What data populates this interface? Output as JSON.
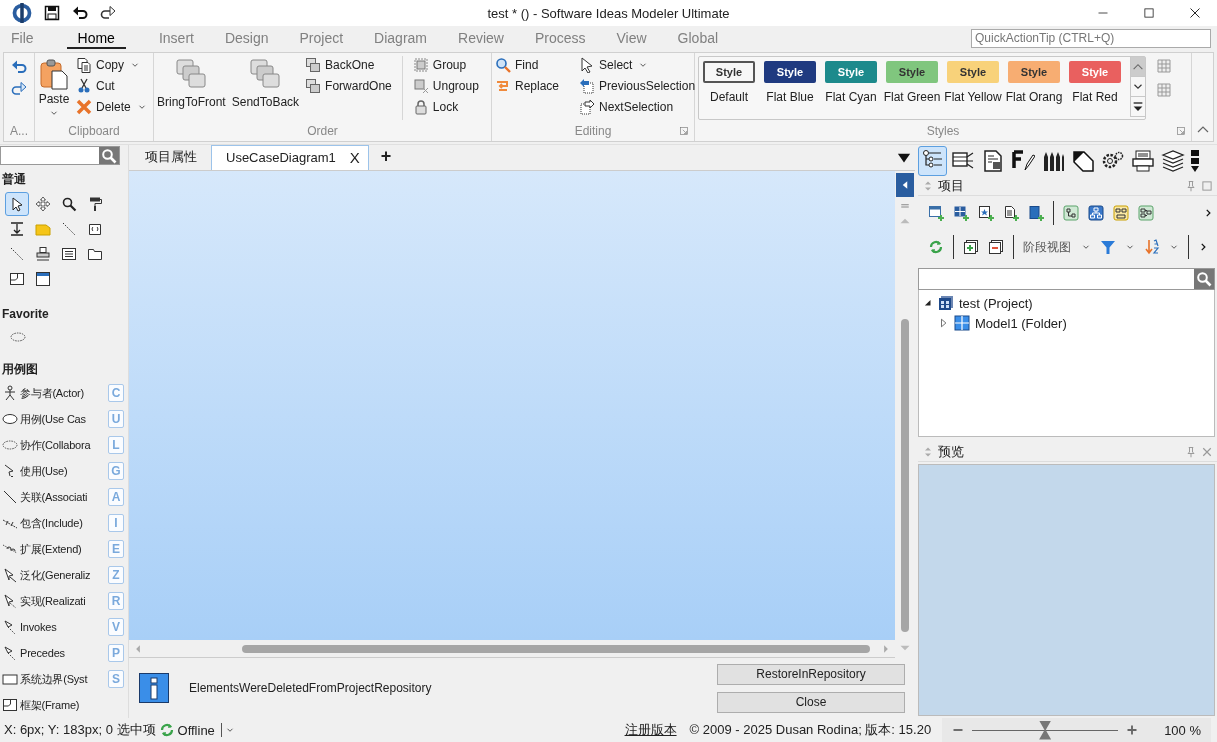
{
  "window": {
    "title": "test *  ()  - Software Ideas Modeler Ultimate"
  },
  "ribbon_tabs": [
    {
      "label": "File",
      "selected": false
    },
    {
      "label": "Home",
      "selected": true
    },
    {
      "label": "Insert",
      "selected": false
    },
    {
      "label": "Design",
      "selected": false
    },
    {
      "label": "Project",
      "selected": false
    },
    {
      "label": "Diagram",
      "selected": false
    },
    {
      "label": "Review",
      "selected": false
    },
    {
      "label": "Process",
      "selected": false
    },
    {
      "label": "View",
      "selected": false
    },
    {
      "label": "Global",
      "selected": false
    }
  ],
  "quick_action": {
    "placeholder": "QuickActionTip (CTRL+Q)"
  },
  "ribbon": {
    "history": {
      "label": "A..."
    },
    "clipboard": {
      "label": "Clipboard",
      "paste": "Paste",
      "copy": "Copy",
      "cut": "Cut",
      "delete": "Delete"
    },
    "order": {
      "label": "Order",
      "large": [
        "BringToFront",
        "SendToBack"
      ],
      "small": [
        "BackOne",
        "ForwardOne"
      ],
      "grouping": [
        "Group",
        "Ungroup",
        "Lock"
      ]
    },
    "editing": {
      "label": "Editing",
      "find": "Find",
      "replace": "Replace",
      "select": "Select",
      "previous": "PreviousSelection",
      "next": "NextSelection"
    },
    "styles": {
      "label": "Styles",
      "items": [
        {
          "chip": "Style",
          "label": "Default",
          "color": "#f7f7f7"
        },
        {
          "chip": "Style",
          "label": "Flat Blue",
          "color": "#1f3a80"
        },
        {
          "chip": "Style",
          "label": "Flat Cyan",
          "color": "#1d8a8c"
        },
        {
          "chip": "Style",
          "label": "Flat Green",
          "color": "#80c67e"
        },
        {
          "chip": "Style",
          "label": "Flat Yellow",
          "color": "#f8d27a"
        },
        {
          "chip": "Style",
          "label": "Flat Orang",
          "color": "#f7ad72"
        },
        {
          "chip": "Style",
          "label": "Flat Red",
          "color": "#e9605f"
        }
      ]
    }
  },
  "toolbox": {
    "general": {
      "title": "普通",
      "tools": [
        {
          "selected": true
        },
        {
          "selected": false
        },
        {
          "selected": false
        },
        {
          "selected": false
        },
        {
          "selected": false
        },
        {
          "selected": false
        },
        {
          "selected": false
        },
        {
          "selected": false
        },
        {
          "selected": false
        },
        {
          "selected": false
        },
        {
          "selected": false
        },
        {
          "selected": false
        },
        {
          "selected": false
        },
        {
          "selected": false
        }
      ]
    },
    "favorite": {
      "title": "Favorite"
    },
    "use_case": {
      "title": "用例图",
      "tools": [
        {
          "label": "参与者(Actor)",
          "key": "C"
        },
        {
          "label": "用例(Use Cas",
          "key": "U"
        },
        {
          "label": "协作(Collabora",
          "key": "L"
        },
        {
          "label": "使用(Use)",
          "key": "G"
        },
        {
          "label": "关联(Associati",
          "key": "A"
        },
        {
          "label": "包含(Include)",
          "key": "I"
        },
        {
          "label": "扩展(Extend)",
          "key": "E"
        },
        {
          "label": "泛化(Generaliz",
          "key": "Z"
        },
        {
          "label": "实现(Realizati",
          "key": "R"
        },
        {
          "label": "Invokes",
          "key": "V"
        },
        {
          "label": "Precedes",
          "key": "P"
        },
        {
          "label": "系统边界(Syst",
          "key": "S"
        },
        {
          "label": "框架(Frame)"
        }
      ]
    }
  },
  "document_tabs": [
    {
      "label": "项目属性",
      "selected": false
    },
    {
      "label": "UseCaseDiagram1",
      "selected": true,
      "close": "X"
    }
  ],
  "add_tab": "+",
  "notification": {
    "message": "ElementsWereDeletedFromProjectRepository",
    "buttons": [
      "RestoreInRepository",
      "Close"
    ]
  },
  "explorer": {
    "views": [
      {
        "selected": true
      },
      {
        "selected": false
      },
      {
        "selected": false
      },
      {
        "selected": false
      },
      {
        "selected": false
      },
      {
        "selected": false
      },
      {
        "selected": false
      },
      {
        "selected": false
      },
      {
        "selected": false
      }
    ],
    "project_panel": {
      "title": "项目",
      "phase_view": "阶段视图",
      "tree": [
        {
          "label": "test (Project)",
          "expanded": true,
          "children": [
            {
              "label": "Model1 (Folder)",
              "expanded": false
            }
          ]
        }
      ]
    },
    "preview_panel": {
      "title": "预览"
    }
  },
  "status_bar": {
    "position": "X: 6px; Y: 183px; 0 选中项",
    "connection": "Offline",
    "register_link": "注册版本",
    "copyright": "© 2009 - 2025 Dusan Rodina; 版本: 15.20",
    "zoom": {
      "level": 0.5,
      "reading": "100 %"
    }
  }
}
